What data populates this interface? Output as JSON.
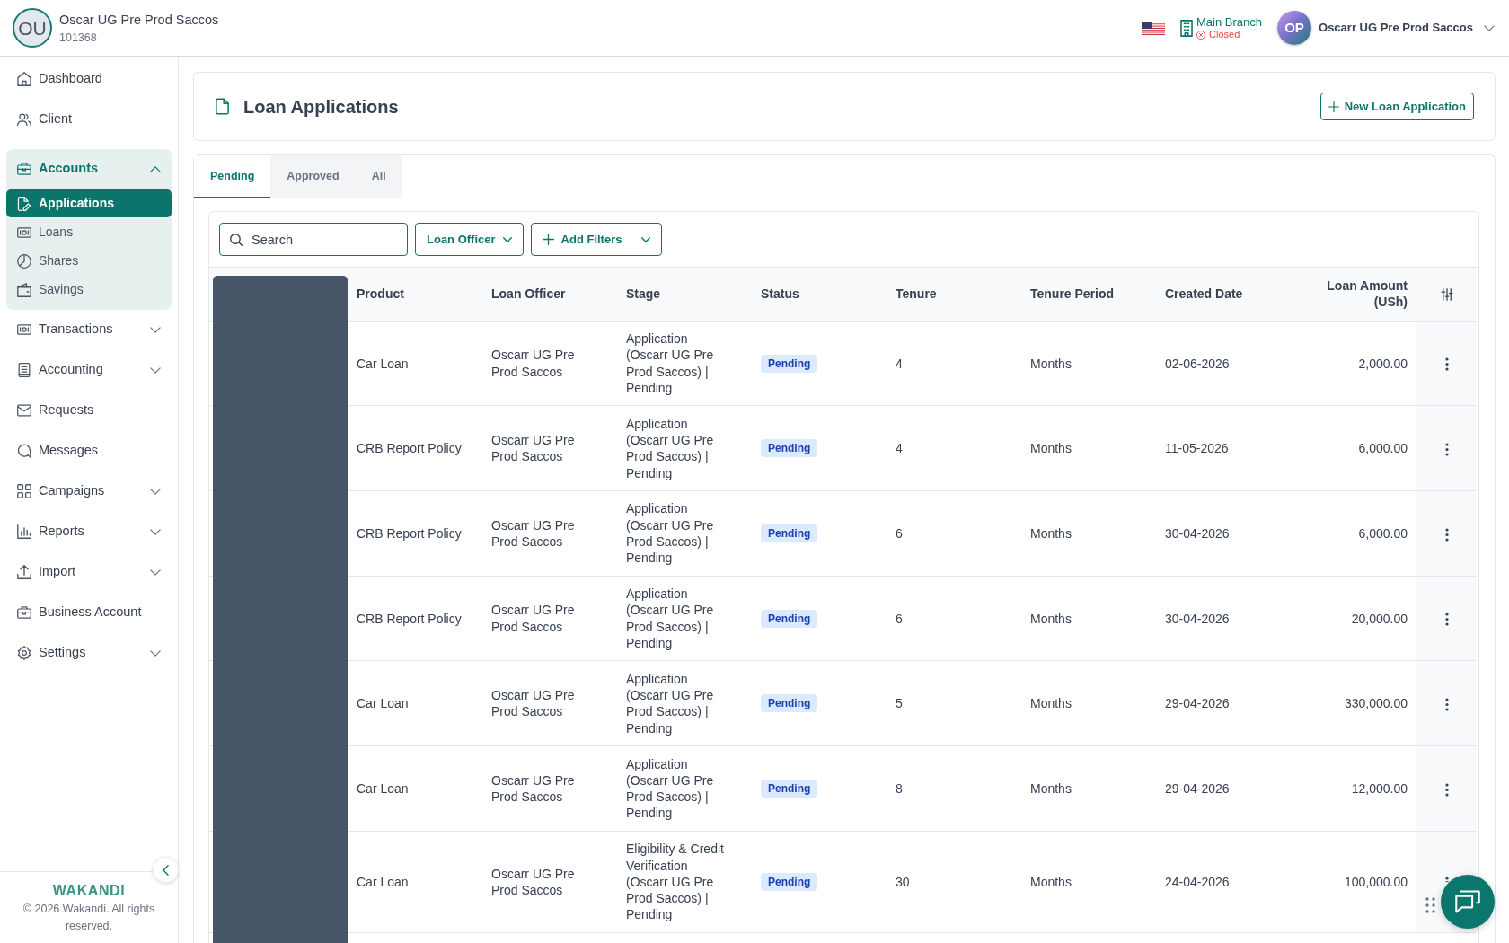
{
  "org": {
    "initials": "OU",
    "name": "Oscar UG Pre Prod Saccos",
    "code": "101368"
  },
  "topbar": {
    "branch": {
      "name": "Main Branch",
      "status": "Closed",
      "open": false
    },
    "user": {
      "initials": "OP",
      "name": "Oscarr UG Pre Prod Saccos"
    }
  },
  "sidebar": {
    "items": [
      {
        "label": "Dashboard",
        "kind": "link",
        "selected": false
      },
      {
        "label": "Client",
        "kind": "link",
        "selected": false
      },
      {
        "label": "Accounts",
        "kind": "group",
        "selected": true,
        "expanded": true,
        "children": [
          {
            "label": "Applications",
            "selected": true
          },
          {
            "label": "Loans",
            "selected": false
          },
          {
            "label": "Shares",
            "selected": false
          },
          {
            "label": "Savings",
            "selected": false
          }
        ]
      },
      {
        "label": "Transactions",
        "kind": "group",
        "selected": false,
        "expanded": false
      },
      {
        "label": "Accounting",
        "kind": "group",
        "selected": false,
        "expanded": false
      },
      {
        "label": "Requests",
        "kind": "link",
        "selected": false
      },
      {
        "label": "Messages",
        "kind": "link",
        "selected": false
      },
      {
        "label": "Campaigns",
        "kind": "group",
        "selected": false,
        "expanded": false
      },
      {
        "label": "Reports",
        "kind": "group",
        "selected": false,
        "expanded": false
      },
      {
        "label": "Import",
        "kind": "group",
        "selected": false,
        "expanded": false
      },
      {
        "label": "Business Account",
        "kind": "link",
        "selected": false
      },
      {
        "label": "Settings",
        "kind": "group",
        "selected": false,
        "expanded": false
      }
    ],
    "footer": {
      "logo": "WAKANDI",
      "copyright": "© 2026 Wakandi. All rights reserved."
    }
  },
  "page": {
    "title": "Loan Applications",
    "new_button": "New Loan Application"
  },
  "tabs": [
    {
      "label": "Pending",
      "selected": true
    },
    {
      "label": "Approved",
      "selected": false
    },
    {
      "label": "All",
      "selected": false
    }
  ],
  "filters": {
    "search": {
      "placeholder": "Search"
    },
    "buttons": [
      {
        "label": "Loan Officer",
        "kind": "select"
      },
      {
        "label": "Add Filters",
        "kind": "add"
      }
    ]
  },
  "table": {
    "columns": [
      {
        "label": "Product",
        "kind": "text"
      },
      {
        "label": "Loan Officer",
        "kind": "text"
      },
      {
        "label": "Stage",
        "kind": "text"
      },
      {
        "label": "Status",
        "kind": "badge"
      },
      {
        "label": "Tenure",
        "kind": "text"
      },
      {
        "label": "Tenure Period",
        "kind": "text"
      },
      {
        "label": "Created Date",
        "kind": "text"
      },
      {
        "label": "Loan Amount (USh)",
        "kind": "amount"
      }
    ],
    "rows": [
      [
        "Car Loan",
        "Oscarr UG Pre Prod Saccos",
        "Application (Oscarr UG Pre Prod Saccos) | Pending",
        "Pending",
        "4",
        "Months",
        "02-06-2026",
        "2,000.00"
      ],
      [
        "CRB Report Policy",
        "Oscarr UG Pre Prod Saccos",
        "Application (Oscarr UG Pre Prod Saccos) | Pending",
        "Pending",
        "4",
        "Months",
        "11-05-2026",
        "6,000.00"
      ],
      [
        "CRB Report Policy",
        "Oscarr UG Pre Prod Saccos",
        "Application (Oscarr UG Pre Prod Saccos) | Pending",
        "Pending",
        "6",
        "Months",
        "30-04-2026",
        "6,000.00"
      ],
      [
        "CRB Report Policy",
        "Oscarr UG Pre Prod Saccos",
        "Application (Oscarr UG Pre Prod Saccos) | Pending",
        "Pending",
        "6",
        "Months",
        "30-04-2026",
        "20,000.00"
      ],
      [
        "Car Loan",
        "Oscarr UG Pre Prod Saccos",
        "Application (Oscarr UG Pre Prod Saccos) | Pending",
        "Pending",
        "5",
        "Months",
        "29-04-2026",
        "330,000.00"
      ],
      [
        "Car Loan",
        "Oscarr UG Pre Prod Saccos",
        "Application (Oscarr UG Pre Prod Saccos) | Pending",
        "Pending",
        "8",
        "Months",
        "29-04-2026",
        "12,000.00"
      ],
      [
        "Car Loan",
        "Oscarr UG Pre Prod Saccos",
        "Eligibility & Credit Verification (Oscarr UG Pre Prod Saccos) | Pending",
        "Pending",
        "30",
        "Months",
        "24-04-2026",
        "100,000.00"
      ]
    ]
  }
}
